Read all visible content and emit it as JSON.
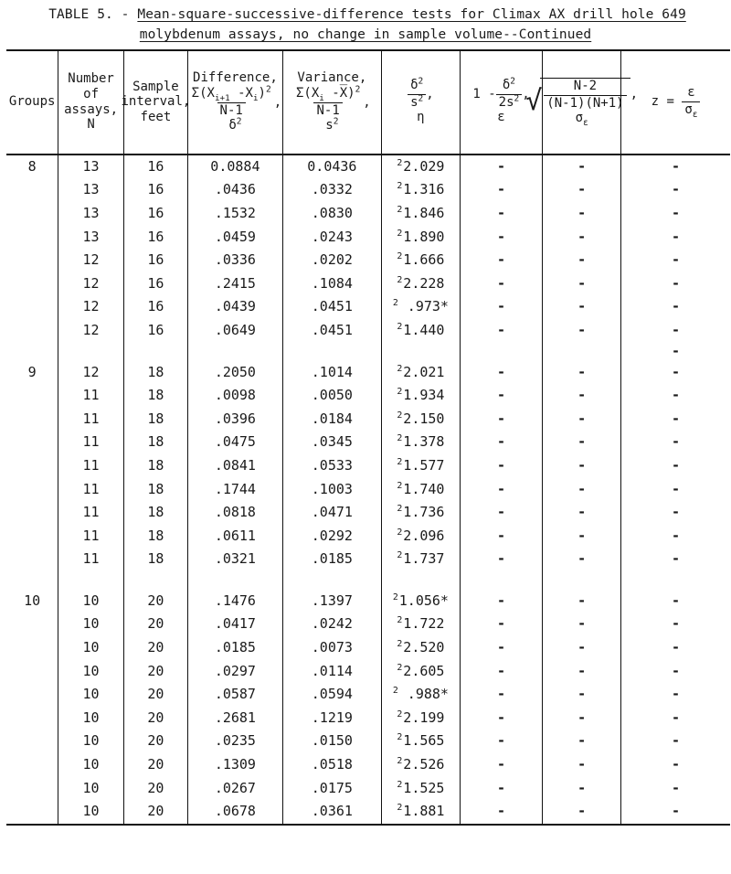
{
  "title": {
    "prefix": "TABLE 5. - ",
    "line1": "Mean-square-successive-difference tests for Climax AX drill hole 649",
    "line2": "molybdenum assays, no change in sample volume--Continued"
  },
  "header": {
    "groups": "Groups",
    "number_of_assays": {
      "l1": "Number",
      "l2": "of",
      "l3": "assays,",
      "l4": "N"
    },
    "sample_interval": {
      "l1": "Sample",
      "l2": "interval,",
      "l3": "feet"
    },
    "difference": {
      "label": "Difference,",
      "numerator": "Σ(X",
      "num_sub1": "i+1",
      "num_mid": " -X",
      "num_sub2": "i",
      "num_end": ")",
      "num_exp": "2",
      "comma": ",",
      "denominator": "N-1",
      "symbol": "δ",
      "symbol_exp": "2"
    },
    "variance": {
      "label": "Variance,",
      "numerator": "Σ(X",
      "num_sub1": "i",
      "num_mid": " -X̅)",
      "num_exp": "2",
      "comma": ",",
      "denominator": "N-1",
      "symbol": "s",
      "symbol_exp": "2"
    },
    "ratio": {
      "numerator": "δ",
      "num_exp": "2",
      "denominator": "s",
      "den_exp": "2",
      "comma": ",",
      "symbol": "η"
    },
    "epsilon": {
      "lead": "1 -",
      "numerator": "δ",
      "num_exp": "2",
      "denominator": "2s",
      "den_exp": "2",
      "comma": ",",
      "symbol": "ε"
    },
    "sigma": {
      "radicand_num": "N-2",
      "radicand_den": "(N-1)(N+1)",
      "comma": ",",
      "symbol": "σ",
      "symbol_sub": "ε"
    },
    "z": {
      "lead": "z  =",
      "numerator": "ε",
      "denominator": "σ",
      "den_sub": "ε"
    }
  },
  "columns": [
    "Groups",
    "Number of assays, N",
    "Sample interval, feet",
    "Difference",
    "Variance",
    "eta",
    "epsilon",
    "sigma-epsilon",
    "z"
  ],
  "blocks": [
    {
      "group": "8",
      "rows": [
        {
          "n": "13",
          "interval": "16",
          "difference": "0.0884",
          "variance": "0.0436",
          "eta_marker": "2",
          "eta": "2.029",
          "eta_star": "",
          "epsilon": "-",
          "sigma": "-",
          "z": "-"
        },
        {
          "n": "13",
          "interval": "16",
          "difference": ".0436",
          "variance": ".0332",
          "eta_marker": "2",
          "eta": "1.316",
          "eta_star": "",
          "epsilon": "-",
          "sigma": "-",
          "z": "-"
        },
        {
          "n": "13",
          "interval": "16",
          "difference": ".1532",
          "variance": ".0830",
          "eta_marker": "2",
          "eta": "1.846",
          "eta_star": "",
          "epsilon": "-",
          "sigma": "-",
          "z": "-"
        },
        {
          "n": "13",
          "interval": "16",
          "difference": ".0459",
          "variance": ".0243",
          "eta_marker": "2",
          "eta": "1.890",
          "eta_star": "",
          "epsilon": "-",
          "sigma": "-",
          "z": "-"
        },
        {
          "n": "12",
          "interval": "16",
          "difference": ".0336",
          "variance": ".0202",
          "eta_marker": "2",
          "eta": "1.666",
          "eta_star": "",
          "epsilon": "-",
          "sigma": "-",
          "z": "-"
        },
        {
          "n": "12",
          "interval": "16",
          "difference": ".2415",
          "variance": ".1084",
          "eta_marker": "2",
          "eta": "2.228",
          "eta_star": "",
          "epsilon": "-",
          "sigma": "-",
          "z": "-"
        },
        {
          "n": "12",
          "interval": "16",
          "difference": ".0439",
          "variance": ".0451",
          "eta_marker": "2",
          "eta": " .973",
          "eta_star": "*",
          "epsilon": "-",
          "sigma": "-",
          "z": "-"
        },
        {
          "n": "12",
          "interval": "16",
          "difference": ".0649",
          "variance": ".0451",
          "eta_marker": "2",
          "eta": "1.440",
          "eta_star": "",
          "epsilon": "-",
          "sigma": "-",
          "z": "-"
        }
      ],
      "gap_after": {
        "epsilon": "",
        "sigma": "",
        "z": "-"
      }
    },
    {
      "group": "9",
      "rows": [
        {
          "n": "12",
          "interval": "18",
          "difference": ".2050",
          "variance": ".1014",
          "eta_marker": "2",
          "eta": "2.021",
          "eta_star": "",
          "epsilon": "-",
          "sigma": "-",
          "z": "-"
        },
        {
          "n": "11",
          "interval": "18",
          "difference": ".0098",
          "variance": ".0050",
          "eta_marker": "2",
          "eta": "1.934",
          "eta_star": "",
          "epsilon": "-",
          "sigma": "-",
          "z": "-"
        },
        {
          "n": "11",
          "interval": "18",
          "difference": ".0396",
          "variance": ".0184",
          "eta_marker": "2",
          "eta": "2.150",
          "eta_star": "",
          "epsilon": "-",
          "sigma": "-",
          "z": "-"
        },
        {
          "n": "11",
          "interval": "18",
          "difference": ".0475",
          "variance": ".0345",
          "eta_marker": "2",
          "eta": "1.378",
          "eta_star": "",
          "epsilon": "-",
          "sigma": "-",
          "z": "-"
        },
        {
          "n": "11",
          "interval": "18",
          "difference": ".0841",
          "variance": ".0533",
          "eta_marker": "2",
          "eta": "1.577",
          "eta_star": "",
          "epsilon": "-",
          "sigma": "-",
          "z": "-"
        },
        {
          "n": "11",
          "interval": "18",
          "difference": ".1744",
          "variance": ".1003",
          "eta_marker": "2",
          "eta": "1.740",
          "eta_star": "",
          "epsilon": "-",
          "sigma": "-",
          "z": "-"
        },
        {
          "n": "11",
          "interval": "18",
          "difference": ".0818",
          "variance": ".0471",
          "eta_marker": "2",
          "eta": "1.736",
          "eta_star": "",
          "epsilon": "-",
          "sigma": "-",
          "z": "-"
        },
        {
          "n": "11",
          "interval": "18",
          "difference": ".0611",
          "variance": ".0292",
          "eta_marker": "2",
          "eta": "2.096",
          "eta_star": "",
          "epsilon": "-",
          "sigma": "-",
          "z": "-"
        },
        {
          "n": "11",
          "interval": "18",
          "difference": ".0321",
          "variance": ".0185",
          "eta_marker": "2",
          "eta": "1.737",
          "eta_star": "",
          "epsilon": "-",
          "sigma": "-",
          "z": "-"
        }
      ],
      "gap_after": {
        "epsilon": "",
        "sigma": "",
        "z": ""
      }
    },
    {
      "group": "10",
      "rows": [
        {
          "n": "10",
          "interval": "20",
          "difference": ".1476",
          "variance": ".1397",
          "eta_marker": "2",
          "eta": "1.056",
          "eta_star": "*",
          "epsilon": "-",
          "sigma": "-",
          "z": "-"
        },
        {
          "n": "10",
          "interval": "20",
          "difference": ".0417",
          "variance": ".0242",
          "eta_marker": "2",
          "eta": "1.722",
          "eta_star": "",
          "epsilon": "-",
          "sigma": "-",
          "z": "-"
        },
        {
          "n": "10",
          "interval": "20",
          "difference": ".0185",
          "variance": ".0073",
          "eta_marker": "2",
          "eta": "2.520",
          "eta_star": "",
          "epsilon": "-",
          "sigma": "-",
          "z": "-"
        },
        {
          "n": "10",
          "interval": "20",
          "difference": ".0297",
          "variance": ".0114",
          "eta_marker": "2",
          "eta": "2.605",
          "eta_star": "",
          "epsilon": "-",
          "sigma": "-",
          "z": "-"
        },
        {
          "n": "10",
          "interval": "20",
          "difference": ".0587",
          "variance": ".0594",
          "eta_marker": "2",
          "eta": " .988",
          "eta_star": "*",
          "epsilon": "-",
          "sigma": "-",
          "z": "-"
        },
        {
          "n": "10",
          "interval": "20",
          "difference": ".2681",
          "variance": ".1219",
          "eta_marker": "2",
          "eta": "2.199",
          "eta_star": "",
          "epsilon": "-",
          "sigma": "-",
          "z": "-"
        },
        {
          "n": "10",
          "interval": "20",
          "difference": ".0235",
          "variance": ".0150",
          "eta_marker": "2",
          "eta": "1.565",
          "eta_star": "",
          "epsilon": "-",
          "sigma": "-",
          "z": "-"
        },
        {
          "n": "10",
          "interval": "20",
          "difference": ".1309",
          "variance": ".0518",
          "eta_marker": "2",
          "eta": "2.526",
          "eta_star": "",
          "epsilon": "-",
          "sigma": "-",
          "z": "-"
        },
        {
          "n": "10",
          "interval": "20",
          "difference": ".0267",
          "variance": ".0175",
          "eta_marker": "2",
          "eta": "1.525",
          "eta_star": "",
          "epsilon": "-",
          "sigma": "-",
          "z": "-"
        },
        {
          "n": "10",
          "interval": "20",
          "difference": ".0678",
          "variance": ".0361",
          "eta_marker": "2",
          "eta": "1.881",
          "eta_star": "",
          "epsilon": "-",
          "sigma": "-",
          "z": "-"
        }
      ],
      "gap_after": null
    }
  ]
}
